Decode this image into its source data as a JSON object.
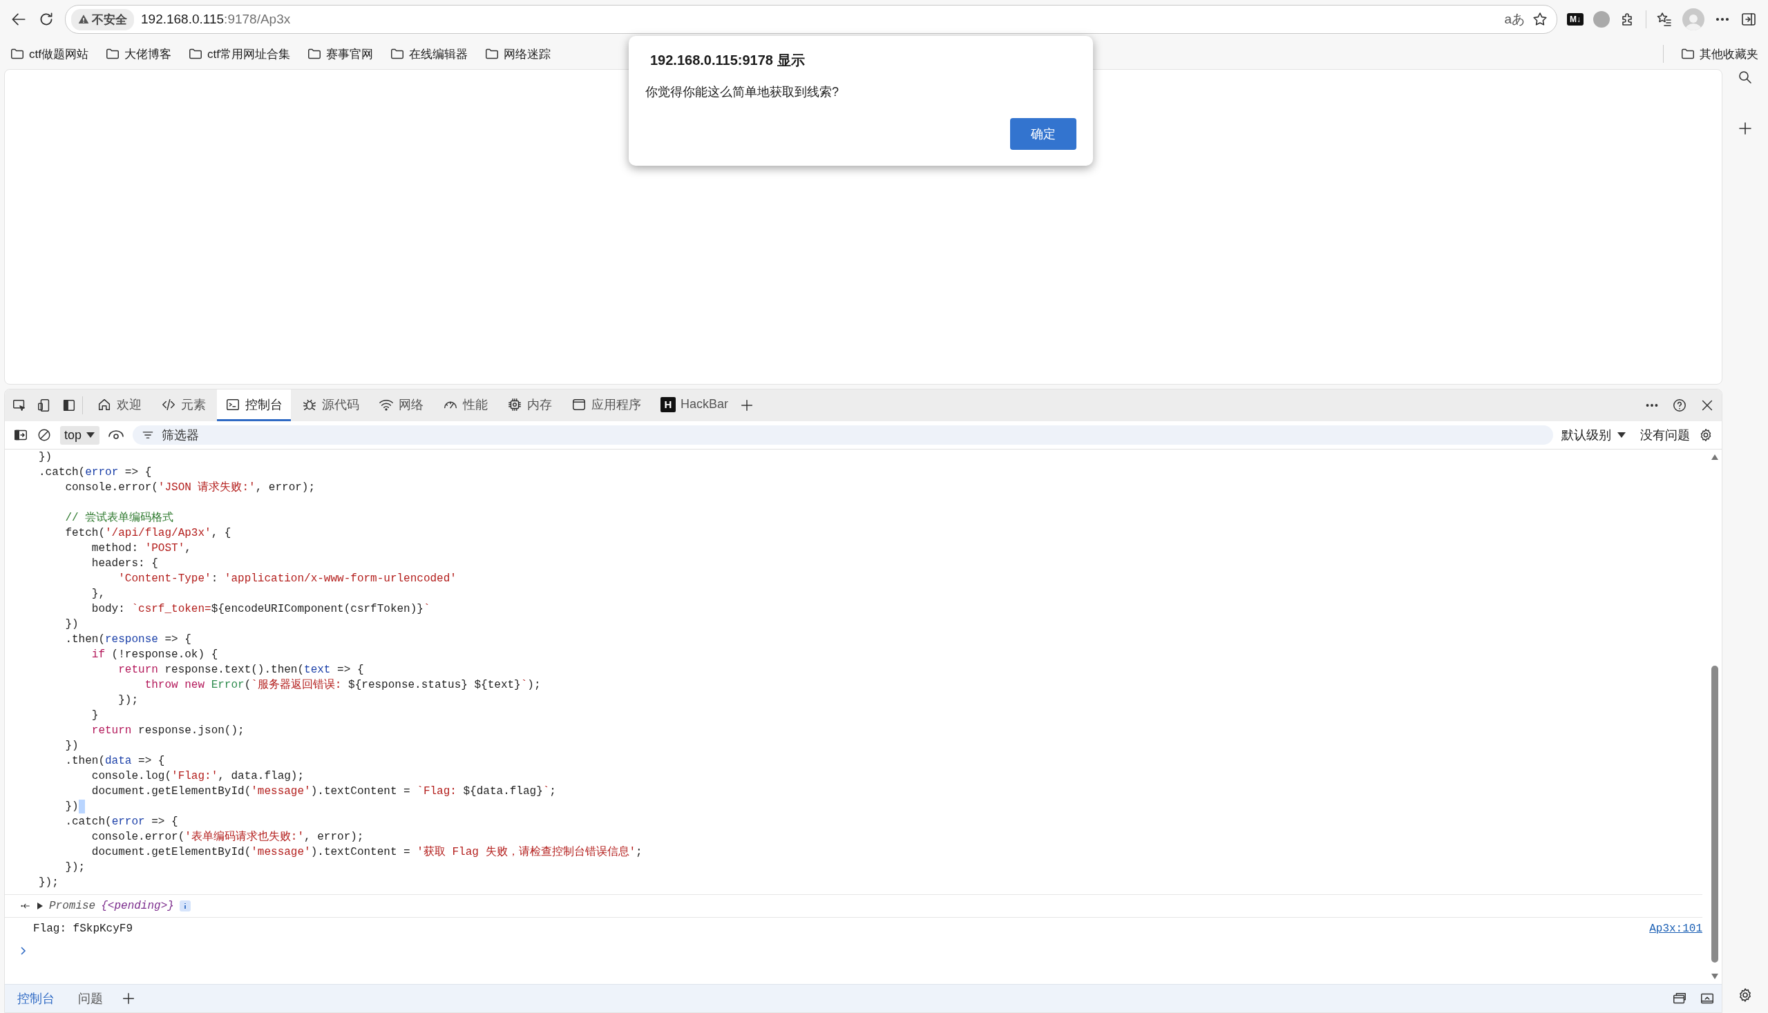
{
  "browser": {
    "security_label": "不安全",
    "url_host": "192.168.0.115",
    "url_rest": ":9178/Ap3x",
    "read_aloud_glyph": "aあ",
    "markdown_badge": "M↓"
  },
  "bookmarks": [
    "ctf做题网站",
    "大佬博客",
    "ctf常用网址合集",
    "赛事官网",
    "在线编辑器",
    "网络迷踪"
  ],
  "other_bookmarks": "其他收藏夹",
  "dialog": {
    "title": "192.168.0.115:9178 显示",
    "message": "你觉得你能这么简单地获取到线索?",
    "ok_button": "确定"
  },
  "devtools": {
    "tabs": [
      {
        "label": "欢迎",
        "selected": false
      },
      {
        "label": "元素",
        "selected": false
      },
      {
        "label": "控制台",
        "selected": true
      },
      {
        "label": "源代码",
        "selected": false
      },
      {
        "label": "网络",
        "selected": false
      },
      {
        "label": "性能",
        "selected": false
      },
      {
        "label": "内存",
        "selected": false
      },
      {
        "label": "应用程序",
        "selected": false
      },
      {
        "label": "HackBar",
        "badge": "H",
        "selected": false
      }
    ],
    "context": "top",
    "filter_placeholder": "筛选器",
    "level_filter": "默认级别",
    "issues": "没有问题",
    "code_lines": [
      {
        "kind": "code",
        "tokens": [
          {
            "kind": "plain",
            "text": "})"
          }
        ]
      },
      {
        "kind": "code",
        "tokens": [
          {
            "kind": "plain",
            "text": ".catch("
          },
          {
            "kind": "param",
            "text": "error"
          },
          {
            "kind": "plain",
            "text": " => {"
          }
        ]
      },
      {
        "kind": "code",
        "tokens": [
          {
            "kind": "plain",
            "text": "    console.error("
          },
          {
            "kind": "string",
            "text": "'JSON 请求失败:'"
          },
          {
            "kind": "plain",
            "text": ", error);"
          }
        ]
      },
      {
        "kind": "blank"
      },
      {
        "kind": "code",
        "tokens": [
          {
            "kind": "comment",
            "text": "    // 尝试表单编码格式"
          }
        ]
      },
      {
        "kind": "code",
        "tokens": [
          {
            "kind": "plain",
            "text": "    fetch("
          },
          {
            "kind": "string",
            "text": "'/api/flag/Ap3x'"
          },
          {
            "kind": "plain",
            "text": ", {"
          }
        ]
      },
      {
        "kind": "code",
        "tokens": [
          {
            "kind": "plain",
            "text": "        method: "
          },
          {
            "kind": "string",
            "text": "'POST'"
          },
          {
            "kind": "plain",
            "text": ","
          }
        ]
      },
      {
        "kind": "code",
        "tokens": [
          {
            "kind": "plain",
            "text": "        headers: {"
          }
        ]
      },
      {
        "kind": "code",
        "tokens": [
          {
            "kind": "string",
            "text": "            'Content-Type'"
          },
          {
            "kind": "plain",
            "text": ": "
          },
          {
            "kind": "string",
            "text": "'application/x-www-form-urlencoded'"
          }
        ]
      },
      {
        "kind": "code",
        "tokens": [
          {
            "kind": "plain",
            "text": "        },"
          }
        ]
      },
      {
        "kind": "code",
        "tokens": [
          {
            "kind": "plain",
            "text": "        body: "
          },
          {
            "kind": "string",
            "text": "`csrf_token="
          },
          {
            "kind": "plain",
            "text": "${encodeURIComponent(csrfToken)}"
          },
          {
            "kind": "string",
            "text": "`"
          }
        ]
      },
      {
        "kind": "code",
        "tokens": [
          {
            "kind": "plain",
            "text": "    })"
          }
        ]
      },
      {
        "kind": "code",
        "tokens": [
          {
            "kind": "plain",
            "text": "    .then("
          },
          {
            "kind": "param",
            "text": "response"
          },
          {
            "kind": "plain",
            "text": " => {"
          }
        ]
      },
      {
        "kind": "code",
        "tokens": [
          {
            "kind": "keyword",
            "text": "        if"
          },
          {
            "kind": "plain",
            "text": " (!response.ok) {"
          }
        ]
      },
      {
        "kind": "code",
        "tokens": [
          {
            "kind": "keyword",
            "text": "            return"
          },
          {
            "kind": "plain",
            "text": " response.text().then("
          },
          {
            "kind": "param",
            "text": "text"
          },
          {
            "kind": "plain",
            "text": " => {"
          }
        ]
      },
      {
        "kind": "code",
        "tokens": [
          {
            "kind": "keyword",
            "text": "                throw new "
          },
          {
            "kind": "builtin",
            "text": "Error"
          },
          {
            "kind": "plain",
            "text": "("
          },
          {
            "kind": "string",
            "text": "`服务器返回错误: "
          },
          {
            "kind": "plain",
            "text": "${response.status} ${text}"
          },
          {
            "kind": "string",
            "text": "`"
          },
          {
            "kind": "plain",
            "text": ");"
          }
        ]
      },
      {
        "kind": "code",
        "tokens": [
          {
            "kind": "plain",
            "text": "            });"
          }
        ]
      },
      {
        "kind": "code",
        "tokens": [
          {
            "kind": "plain",
            "text": "        }"
          }
        ]
      },
      {
        "kind": "code",
        "tokens": [
          {
            "kind": "keyword",
            "text": "        return"
          },
          {
            "kind": "plain",
            "text": " response.json();"
          }
        ]
      },
      {
        "kind": "code",
        "tokens": [
          {
            "kind": "plain",
            "text": "    })"
          }
        ]
      },
      {
        "kind": "code",
        "tokens": [
          {
            "kind": "plain",
            "text": "    .then("
          },
          {
            "kind": "param",
            "text": "data"
          },
          {
            "kind": "plain",
            "text": " => {"
          }
        ]
      },
      {
        "kind": "code",
        "tokens": [
          {
            "kind": "plain",
            "text": "        console.log("
          },
          {
            "kind": "string",
            "text": "'Flag:'"
          },
          {
            "kind": "plain",
            "text": ", data.flag);"
          }
        ]
      },
      {
        "kind": "code",
        "tokens": [
          {
            "kind": "plain",
            "text": "        document.getElementById("
          },
          {
            "kind": "string",
            "text": "'message'"
          },
          {
            "kind": "plain",
            "text": ").textContent = "
          },
          {
            "kind": "string",
            "text": "`Flag: "
          },
          {
            "kind": "plain",
            "text": "${data.flag}"
          },
          {
            "kind": "string",
            "text": "`"
          },
          {
            "kind": "plain",
            "text": ";"
          }
        ]
      },
      {
        "kind": "code",
        "tokens": [
          {
            "kind": "plain",
            "text": "    })"
          }
        ],
        "cursor": true
      },
      {
        "kind": "code",
        "tokens": [
          {
            "kind": "plain",
            "text": "    .catch("
          },
          {
            "kind": "param",
            "text": "error"
          },
          {
            "kind": "plain",
            "text": " => {"
          }
        ]
      },
      {
        "kind": "code",
        "tokens": [
          {
            "kind": "plain",
            "text": "        console.error("
          },
          {
            "kind": "string",
            "text": "'表单编码请求也失败:'"
          },
          {
            "kind": "plain",
            "text": ", error);"
          }
        ]
      },
      {
        "kind": "code",
        "tokens": [
          {
            "kind": "plain",
            "text": "        document.getElementById("
          },
          {
            "kind": "string",
            "text": "'message'"
          },
          {
            "kind": "plain",
            "text": ").textContent = "
          },
          {
            "kind": "string",
            "text": "'获取 Flag 失败，请检查控制台错误信息'"
          },
          {
            "kind": "plain",
            "text": ";"
          }
        ]
      },
      {
        "kind": "code",
        "tokens": [
          {
            "kind": "plain",
            "text": "    });"
          }
        ]
      },
      {
        "kind": "code",
        "tokens": [
          {
            "kind": "plain",
            "text": "});"
          }
        ]
      }
    ],
    "result": {
      "type": "Promise",
      "value": "{<pending>}"
    },
    "log": {
      "text": "Flag: fSkpKcyF9",
      "source": "Ap3x:101"
    },
    "drawer_tabs": [
      {
        "label": "控制台",
        "selected": true
      },
      {
        "label": "问题",
        "selected": false
      }
    ]
  }
}
